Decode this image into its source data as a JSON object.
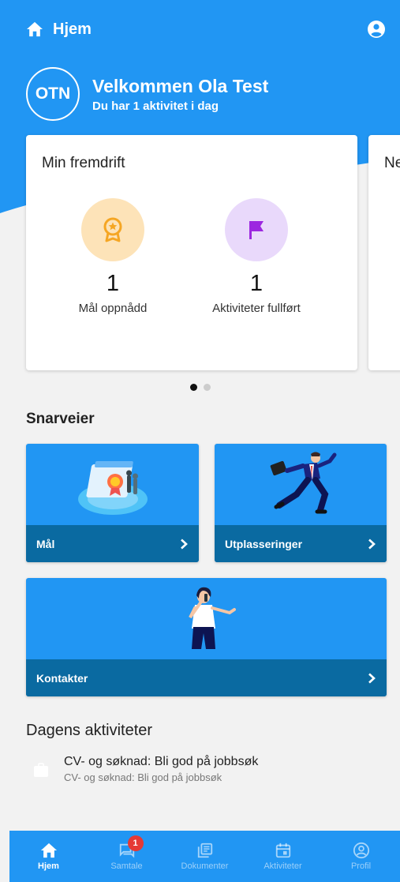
{
  "header": {
    "title": "Hjem",
    "home_icon": "home-icon",
    "account_icon": "account-circle-icon"
  },
  "welcome": {
    "initials": "OTN",
    "title": "Velkommen Ola Test",
    "subtitle": "Du har 1 aktivitet i dag"
  },
  "progress": {
    "title": "Min fremdrift",
    "stats": [
      {
        "value": "1",
        "label": "Mål oppnådd",
        "icon": "award-icon",
        "color": "#fde3b8",
        "icon_color": "#f5a623"
      },
      {
        "value": "1",
        "label": "Aktiviteter fullført",
        "icon": "flag-icon",
        "color": "#e9d9fb",
        "icon_color": "#9c27e0"
      }
    ]
  },
  "next_card": {
    "title_partial": "Ne"
  },
  "carousel": {
    "count": 2,
    "active": 0
  },
  "shortcuts": {
    "title": "Snarveier",
    "items": [
      {
        "label": "Mål",
        "icon": "goal-illustration"
      },
      {
        "label": "Utplasseringer",
        "icon": "running-man-illustration"
      },
      {
        "label": "Kontakter",
        "icon": "phone-woman-illustration"
      }
    ]
  },
  "today": {
    "title": "Dagens aktiviteter",
    "items": [
      {
        "title": "CV- og søknad: Bli god på jobbsøk",
        "subtitle": "CV- og søknad: Bli god på jobbsøk",
        "icon": "briefcase-icon"
      }
    ]
  },
  "nav": {
    "items": [
      {
        "label": "Hjem",
        "icon": "home-icon",
        "active": true
      },
      {
        "label": "Samtale",
        "icon": "chat-icon",
        "badge": "1"
      },
      {
        "label": "Dokumenter",
        "icon": "documents-icon"
      },
      {
        "label": "Aktiviteter",
        "icon": "calendar-icon"
      },
      {
        "label": "Profil",
        "icon": "profile-icon"
      }
    ]
  },
  "colors": {
    "primary": "#2196f3",
    "dark_bar": "#0a6aa1",
    "badge": "#e53935"
  }
}
